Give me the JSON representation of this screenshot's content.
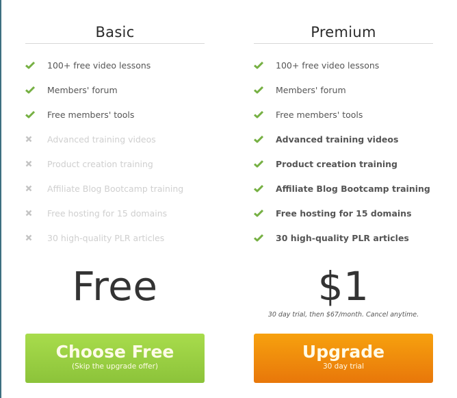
{
  "colors": {
    "check": "#76b043",
    "cross": "#c4c4c4",
    "green_button": "#9ad043",
    "orange_button": "#f08a0c"
  },
  "plans": [
    {
      "name": "Basic",
      "features": [
        {
          "label": "100+ free video lessons",
          "included": true,
          "icon": "check-icon"
        },
        {
          "label": "Members' forum",
          "included": true,
          "icon": "check-icon"
        },
        {
          "label": "Free members' tools",
          "included": true,
          "icon": "check-icon"
        },
        {
          "label": "Advanced training videos",
          "included": false,
          "icon": "cross-icon"
        },
        {
          "label": "Product creation training",
          "included": false,
          "icon": "cross-icon"
        },
        {
          "label": "Affiliate Blog Bootcamp training",
          "included": false,
          "icon": "cross-icon"
        },
        {
          "label": "Free hosting for 15 domains",
          "included": false,
          "icon": "cross-icon"
        },
        {
          "label": "30 high-quality PLR articles",
          "included": false,
          "icon": "cross-icon"
        }
      ],
      "price": "Free",
      "price_note": "",
      "cta": {
        "label": "Choose Free",
        "sublabel": "(Skip the upgrade offer)"
      }
    },
    {
      "name": "Premium",
      "features": [
        {
          "label": "100+ free video lessons",
          "included": true,
          "icon": "check-icon"
        },
        {
          "label": "Members' forum",
          "included": true,
          "icon": "check-icon"
        },
        {
          "label": "Free members' tools",
          "included": true,
          "icon": "check-icon"
        },
        {
          "label": "Advanced training videos",
          "included": true,
          "icon": "check-icon"
        },
        {
          "label": "Product creation training",
          "included": true,
          "icon": "check-icon"
        },
        {
          "label": "Affiliate Blog Bootcamp training",
          "included": true,
          "icon": "check-icon"
        },
        {
          "label": "Free hosting for 15 domains",
          "included": true,
          "icon": "check-icon"
        },
        {
          "label": "30 high-quality PLR articles",
          "included": true,
          "icon": "check-icon"
        }
      ],
      "price": "$1",
      "price_note": "30 day trial, then $67/month. Cancel anytime.",
      "cta": {
        "label": "Upgrade",
        "sublabel": "30 day trial"
      }
    }
  ]
}
